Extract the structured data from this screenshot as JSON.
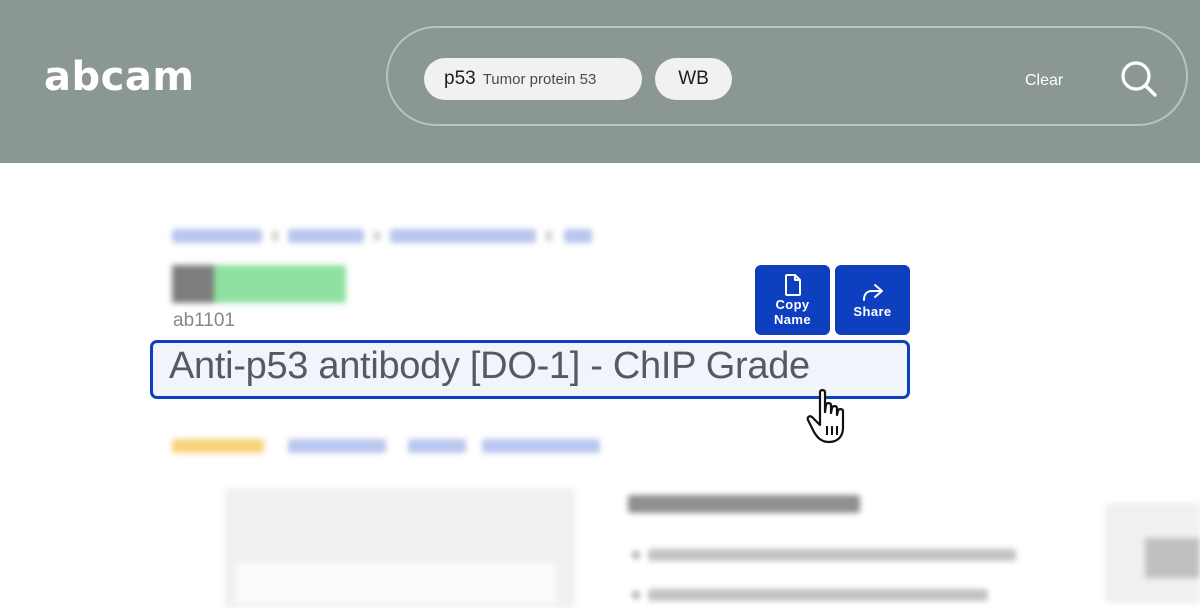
{
  "header": {
    "logo": "abcam",
    "search": {
      "chips": [
        {
          "main": "p53",
          "sub": "Tumor protein 53"
        },
        {
          "main": "WB"
        }
      ],
      "clear_label": "Clear",
      "search_icon": "search-icon"
    }
  },
  "product": {
    "sku": "ab1101",
    "title": "Anti-p53 antibody [DO-1] - ChIP Grade",
    "actions": [
      {
        "label": "Copy Name",
        "icon": "file-icon"
      },
      {
        "label": "Share",
        "icon": "share-icon"
      }
    ]
  },
  "colors": {
    "header_bg": "#8a9794",
    "accent_blue": "#0d3fbf",
    "title_text": "#555a62"
  },
  "cursor_icon": "hand-pointer-icon"
}
